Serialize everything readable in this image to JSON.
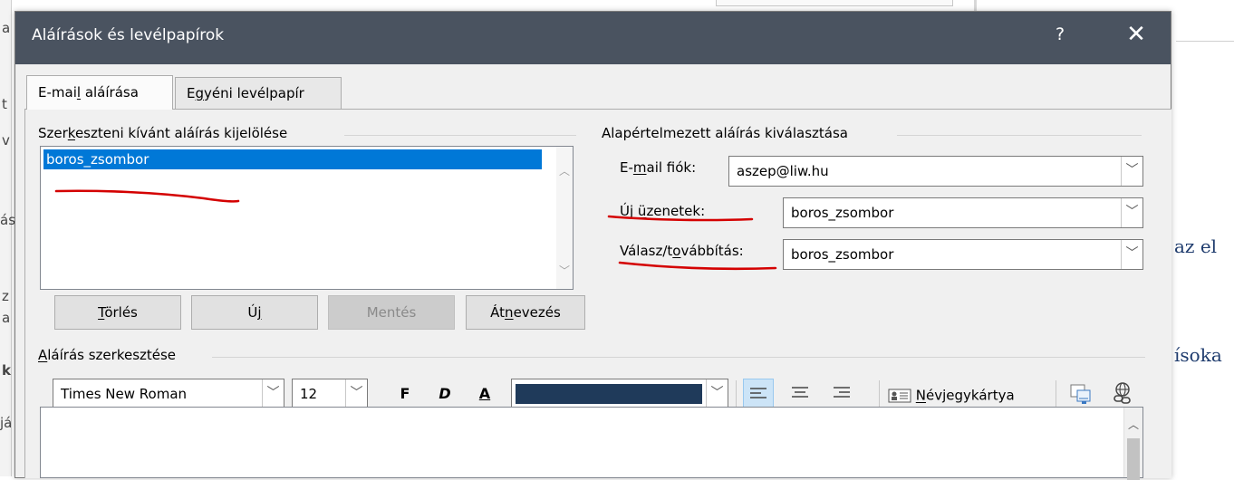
{
  "dialog": {
    "title": "Aláírások és levélpapírok",
    "help": "?",
    "close": "✕"
  },
  "tabs": [
    {
      "label_pre": "E-mai",
      "label_key": "l",
      "label_post": " aláírása",
      "active": true
    },
    {
      "label_pre": "E",
      "label_key": "g",
      "label_post": "yéni levélpapír",
      "active": false
    }
  ],
  "edit_section": {
    "label_pre": "Szer",
    "label_key": "k",
    "label_post": "eszteni kívánt aláírás kijelölése",
    "list_items": [
      "boros_zsombor"
    ],
    "buttons": {
      "delete": {
        "pre": "",
        "key": "T",
        "post": "örlés"
      },
      "new": {
        "pre": "Ú",
        "key": "j",
        "post": ""
      },
      "save": {
        "label": "Mentés",
        "disabled": true
      },
      "rename": {
        "pre": "Át",
        "key": "n",
        "post": "evezés"
      }
    }
  },
  "default_section": {
    "label": "Alapértelmezett aláírás kiválasztása",
    "account": {
      "label_pre": "E-",
      "label_key": "m",
      "label_post": "ail fiók:",
      "value": "aszep@liw.hu"
    },
    "new_messages": {
      "label_pre": "Új ",
      "label_key": "ü",
      "label_post": "zenetek:",
      "value": "boros_zsombor"
    },
    "replies": {
      "label_pre": "Válasz/t",
      "label_key": "o",
      "label_post": "vábbítás:",
      "value": "boros_zsombor"
    }
  },
  "editor_section": {
    "label_pre": "",
    "label_key": "A",
    "label_post": "láírás szerkesztése",
    "font": "Times New Roman",
    "size": "12",
    "bold": "F",
    "italic": "D",
    "underline": "A",
    "font_color": "#1f3a5a",
    "business_card_pre": "",
    "business_card_key": "N",
    "business_card_post": "évjegykártya"
  },
  "background": {
    "left_fragments": [
      "a",
      "t",
      "v",
      "ás",
      "z",
      "a",
      "k",
      "já"
    ],
    "right_fragments": [
      "az el",
      "ísoka"
    ]
  },
  "colors": {
    "titlebar": "#4a5360",
    "selection": "#0078d7",
    "annotation": "#d40000"
  }
}
